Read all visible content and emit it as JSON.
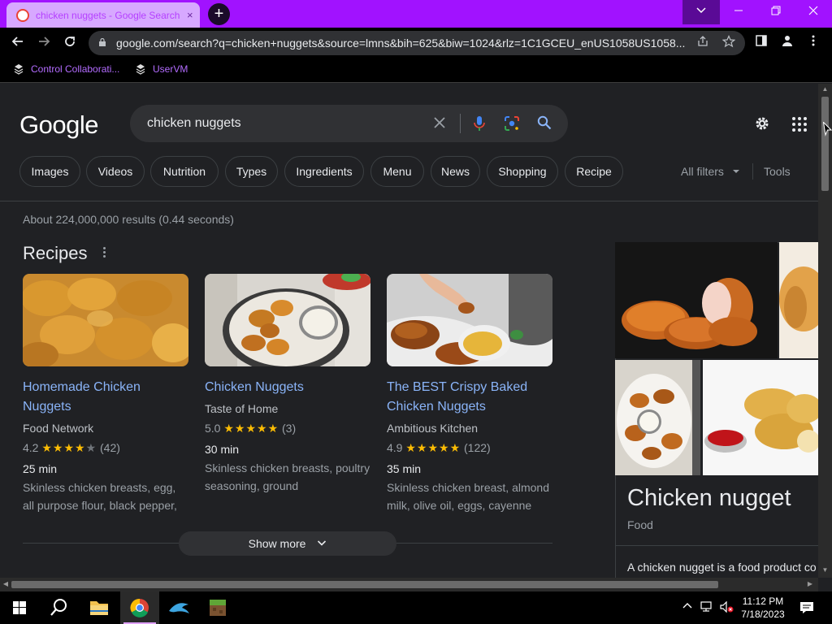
{
  "browser": {
    "tab_title": "chicken nuggets - Google Search",
    "tab_close": "×",
    "new_tab": "+",
    "url": "google.com/search?q=chicken+nuggets&source=lmns&bih=625&biw=1024&rlz=1C1GCEU_enUS1058US1058...",
    "bookmarks": [
      "Control Collaborati...",
      "UserVM"
    ]
  },
  "search": {
    "logo": "Google",
    "query": "chicken nuggets",
    "chips": [
      "Images",
      "Videos",
      "Nutrition",
      "Types",
      "Ingredients",
      "Menu",
      "News",
      "Shopping",
      "Recipe"
    ],
    "all_filters": "All filters",
    "tools": "Tools",
    "stats": "About 224,000,000 results (0.44 seconds)"
  },
  "recipes": {
    "title": "Recipes",
    "show_more": "Show more",
    "cards": [
      {
        "title": "Homemade Chicken Nuggets",
        "source": "Food Network",
        "rating": "4.2",
        "stars": 4,
        "reviews": "(42)",
        "time": "25 min",
        "ingredients": "Skinless chicken breasts, egg, all purpose flour, black pepper,"
      },
      {
        "title": "Chicken Nuggets",
        "source": "Taste of Home",
        "rating": "5.0",
        "stars": 5,
        "reviews": "(3)",
        "time": "30 min",
        "ingredients": "Skinless chicken breasts, poultry seasoning, ground"
      },
      {
        "title": "The BEST Crispy Baked Chicken Nuggets",
        "source": "Ambitious Kitchen",
        "rating": "4.9",
        "stars": 5,
        "reviews": "(122)",
        "time": "35 min",
        "ingredients": "Skinless chicken breast, almond milk, olive oil, eggs, cayenne"
      }
    ]
  },
  "knowledge_panel": {
    "title": "Chicken nugget",
    "subtitle": "Food",
    "description": "A chicken nugget is a food product co"
  },
  "taskbar": {
    "time": "11:12 PM",
    "date": "7/18/2023"
  },
  "colors": {
    "tabstrip": "#a112ff",
    "link": "#8ab4f8",
    "star": "#fbbc04",
    "page_bg": "#202124"
  }
}
